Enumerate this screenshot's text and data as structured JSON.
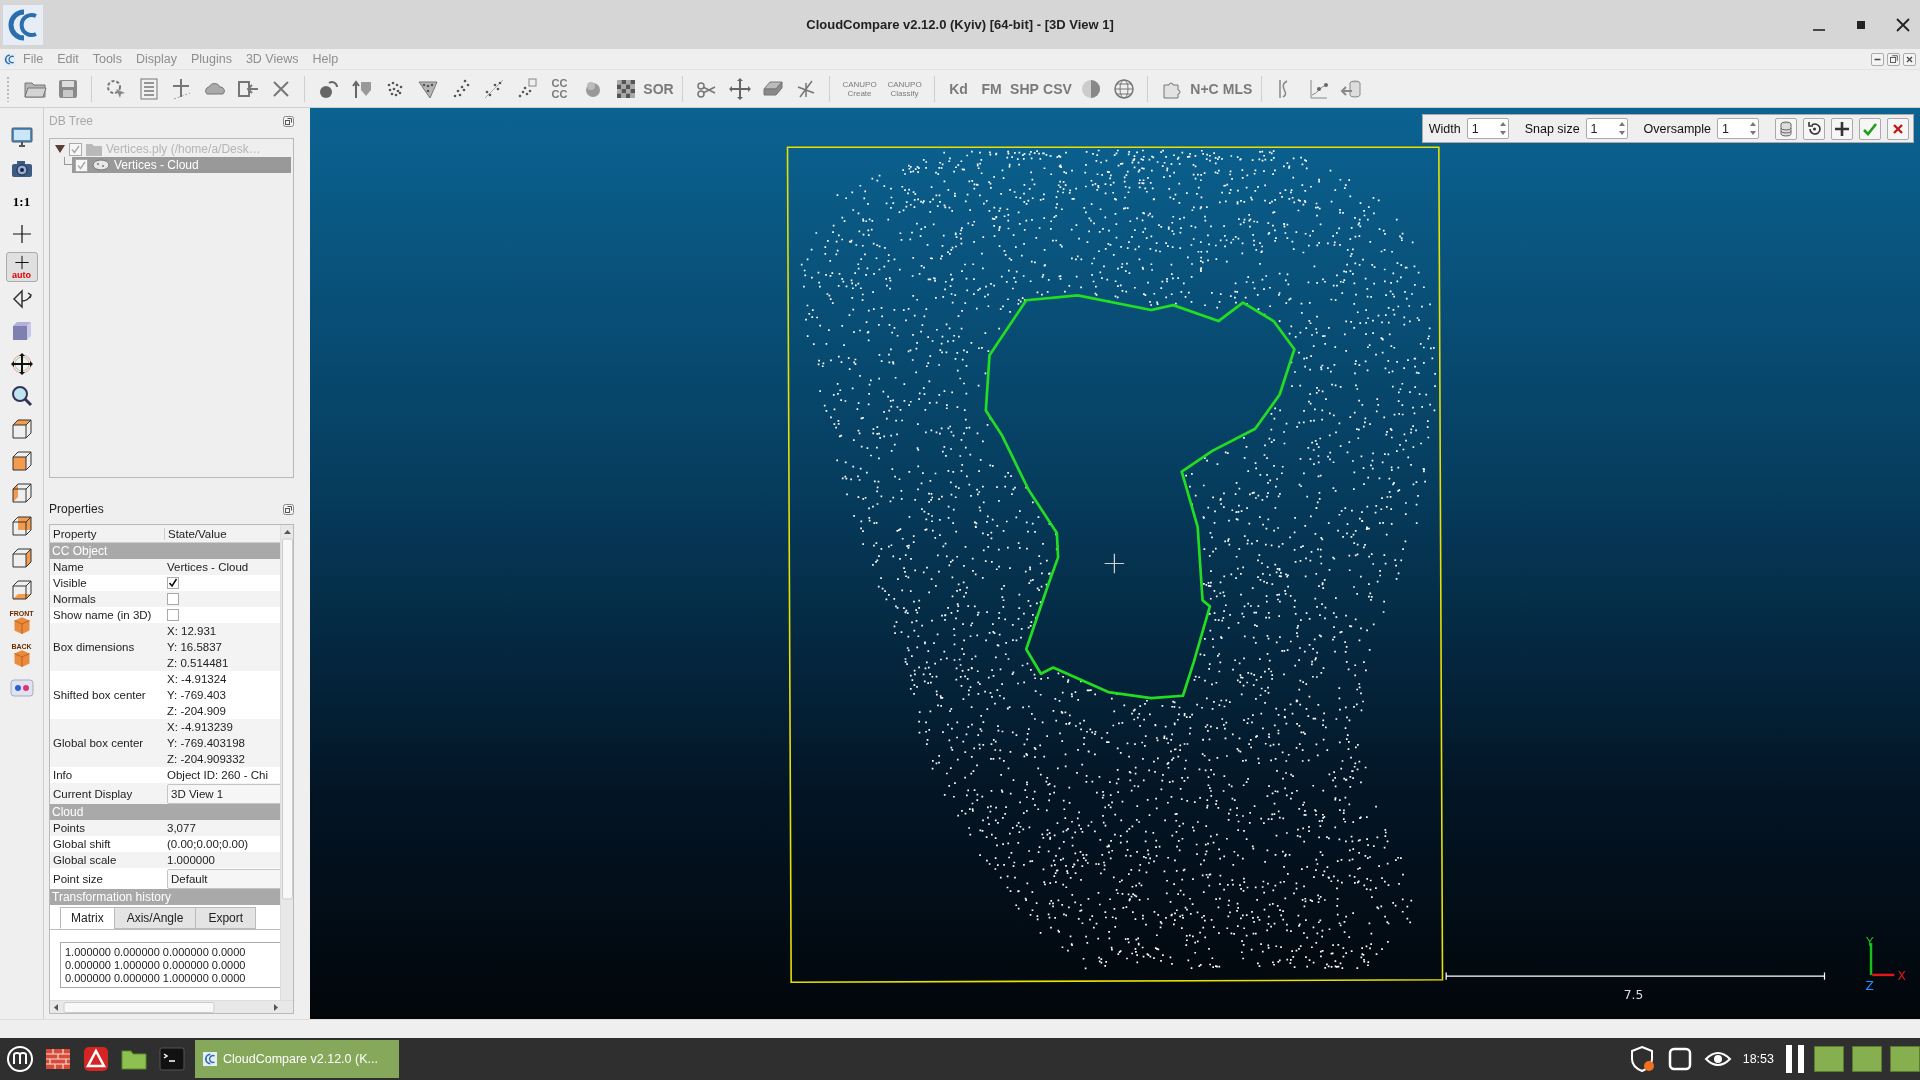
{
  "window": {
    "title": "CloudCompare v2.12.0 (Kyiv) [64-bit] - [3D View 1]"
  },
  "menu": [
    {
      "label": "File"
    },
    {
      "label": "Edit"
    },
    {
      "label": "Tools"
    },
    {
      "label": "Display"
    },
    {
      "label": "Plugins"
    },
    {
      "label": "3D Views"
    },
    {
      "label": "Help"
    }
  ],
  "main_toolbar": [
    [
      {
        "kind": "glyph"
      },
      {
        "kind": "glyph"
      }
    ],
    [
      {
        "kind": "glyph"
      },
      {
        "kind": "glyph"
      },
      {
        "kind": "glyph"
      },
      {
        "kind": "glyph"
      },
      {
        "kind": "glyph"
      },
      {
        "kind": "glyph"
      }
    ],
    [
      {
        "kind": "glyph"
      },
      {
        "kind": "glyph"
      },
      {
        "kind": "glyph"
      },
      {
        "kind": "glyph"
      },
      {
        "kind": "glyph"
      },
      {
        "kind": "glyph"
      },
      {
        "kind": "glyph"
      },
      {
        "kind": "label",
        "lines": [
          "CC",
          "CC"
        ]
      },
      {
        "kind": "glyph"
      },
      {
        "kind": "glyph"
      },
      {
        "kind": "label",
        "lines": [
          "SOR"
        ]
      }
    ],
    [
      {
        "kind": "glyph"
      },
      {
        "kind": "glyph"
      },
      {
        "kind": "glyph"
      },
      {
        "kind": "glyph"
      }
    ],
    [
      {
        "kind": "label",
        "lines": [
          "CANUPO",
          "Create"
        ]
      },
      {
        "kind": "label",
        "lines": [
          "CANUPO",
          "Classify"
        ]
      }
    ],
    [
      {
        "kind": "label",
        "lines": [
          "Kd"
        ]
      },
      {
        "kind": "label",
        "lines": [
          "FM"
        ]
      },
      {
        "kind": "label",
        "lines": [
          "SHP"
        ]
      },
      {
        "kind": "label",
        "lines": [
          "CSV"
        ]
      },
      {
        "kind": "glyph"
      },
      {
        "kind": "glyph"
      }
    ],
    [
      {
        "kind": "glyph"
      },
      {
        "kind": "label",
        "lines": [
          "N+C"
        ]
      },
      {
        "kind": "label",
        "lines": [
          "MLS"
        ]
      }
    ],
    [
      {
        "kind": "glyph"
      },
      {
        "kind": "glyph"
      },
      {
        "kind": "glyph"
      }
    ]
  ],
  "left_toolbar": [
    {
      "kind": "glyph",
      "selected": false
    },
    {
      "kind": "glyph",
      "selected": false
    },
    {
      "kind": "label",
      "lines": [
        "1:1"
      ],
      "selected": false
    },
    {
      "kind": "glyph",
      "selected": false
    },
    {
      "kind": "glyph_label",
      "lines": [
        "auto"
      ],
      "selected": true
    },
    {
      "kind": "glyph",
      "selected": false
    },
    {
      "kind": "glyph",
      "selected": false
    },
    {
      "kind": "glyph",
      "selected": false
    },
    {
      "kind": "glyph",
      "selected": false
    },
    {
      "kind": "glyph",
      "selected": false
    },
    {
      "kind": "glyph",
      "selected": false
    },
    {
      "kind": "glyph",
      "selected": false
    },
    {
      "kind": "glyph",
      "selected": false
    },
    {
      "kind": "glyph",
      "selected": false
    },
    {
      "kind": "glyph",
      "selected": false
    },
    {
      "kind": "glyph_label",
      "lines": [
        "FRONT"
      ],
      "selected": false
    },
    {
      "kind": "glyph_label",
      "lines": [
        "BACK"
      ],
      "selected": false
    },
    {
      "kind": "glyph",
      "selected": false
    }
  ],
  "db_tree": {
    "title": "DB Tree",
    "items": [
      {
        "label": "Vertices.ply (/home/a/Desk…",
        "kind": "folder",
        "checked": true,
        "expanded": true,
        "selected": false,
        "disabled": true,
        "children": [
          {
            "label": "Vertices - Cloud",
            "kind": "cloud",
            "checked": true,
            "selected": true,
            "disabled": false
          }
        ]
      }
    ]
  },
  "properties": {
    "title": "Properties",
    "columns": [
      "Property",
      "State/Value"
    ],
    "rows": [
      {
        "kind": "section",
        "label": "CC Object"
      },
      {
        "kind": "text",
        "label": "Name",
        "value": "Vertices - Cloud"
      },
      {
        "kind": "check",
        "label": "Visible",
        "checked": true
      },
      {
        "kind": "check",
        "label": "Normals",
        "checked": false
      },
      {
        "kind": "check",
        "label": "Show name (in 3D)",
        "checked": false
      },
      {
        "kind": "multi",
        "label": "Box dimensions",
        "values": [
          "X: 12.931",
          "Y: 16.5837",
          "Z: 0.514481"
        ]
      },
      {
        "kind": "multi",
        "label": "Shifted box center",
        "values": [
          "X: -4.91324",
          "Y: -769.403",
          "Z: -204.909"
        ]
      },
      {
        "kind": "multi",
        "label": "Global box center",
        "values": [
          "X: -4.913239",
          "Y: -769.403198",
          "Z: -204.909332"
        ]
      },
      {
        "kind": "text",
        "label": "Info",
        "value": "Object ID: 260 - Chi"
      },
      {
        "kind": "combo",
        "label": "Current Display",
        "value": "3D View 1"
      },
      {
        "kind": "section",
        "label": "Cloud"
      },
      {
        "kind": "text",
        "label": "Points",
        "value": "3,077"
      },
      {
        "kind": "text",
        "label": "Global shift",
        "value": "(0.00;0.00;0.00)"
      },
      {
        "kind": "text",
        "label": "Global scale",
        "value": "1.000000"
      },
      {
        "kind": "combo",
        "label": "Point size",
        "value": "Default"
      },
      {
        "kind": "section",
        "label": "Transformation history"
      }
    ],
    "history_tabs": [
      {
        "label": "Matrix",
        "selected": true
      },
      {
        "label": "Axis/Angle",
        "selected": false
      },
      {
        "label": "Export",
        "selected": false
      }
    ],
    "matrix_lines": [
      "1.000000 0.000000 0.000000 0.0000",
      "0.000000 1.000000 0.000000 0.0000",
      "0.000000 0.000000 1.000000 0.0000"
    ]
  },
  "view": {
    "toolbar": {
      "fields": [
        {
          "label": "Width",
          "value": "1"
        },
        {
          "label": "Snap size",
          "value": "1"
        },
        {
          "label": "Oversample",
          "value": "1"
        }
      ],
      "buttons": [
        {
          "kind": "export"
        },
        {
          "kind": "undo"
        },
        {
          "kind": "add"
        },
        {
          "kind": "confirm"
        },
        {
          "kind": "cancel"
        }
      ]
    },
    "scale_label": "7.5",
    "axes": [
      {
        "label": "X",
        "color": "#e01818"
      },
      {
        "label": "Y",
        "color": "#18c018"
      },
      {
        "label": "Z",
        "color": "#1e90ff"
      }
    ]
  },
  "taskbar": {
    "launchers": [
      {
        "kind": "menu"
      },
      {
        "kind": "firewall"
      },
      {
        "kind": "app"
      },
      {
        "kind": "files"
      },
      {
        "kind": "terminal"
      }
    ],
    "task": {
      "label": "CloudCompare v2.12.0 (K...",
      "selected": true
    },
    "tray": [
      {
        "kind": "shield"
      },
      {
        "kind": "window"
      },
      {
        "kind": "nvidia"
      }
    ],
    "clock": "18:53"
  }
}
